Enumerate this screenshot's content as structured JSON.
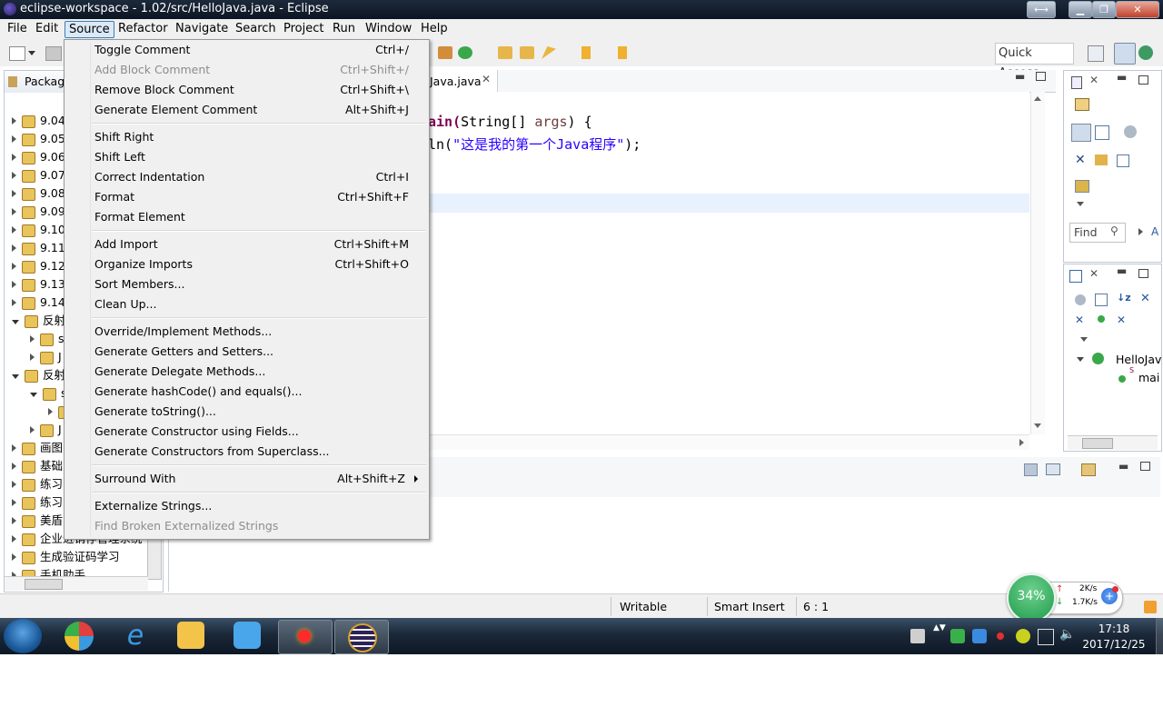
{
  "window": {
    "title": "eclipse-workspace - 1.02/src/HelloJava.java - Eclipse"
  },
  "menubar": [
    "File",
    "Edit",
    "Source",
    "Refactor",
    "Navigate",
    "Search",
    "Project",
    "Run",
    "Window",
    "Help"
  ],
  "toolbar": {
    "quick_access": "Quick Access"
  },
  "package_explorer": {
    "tab_label": "Packag",
    "rows": [
      "9.04",
      "9.05",
      "9.06",
      "9.07",
      "9.08",
      "9.09",
      "9.10",
      "9.11",
      "9.12",
      "9.13",
      "9.14",
      "反射",
      "s",
      "J",
      "反射",
      "s",
      "",
      "J",
      "画图",
      "基础",
      "练习",
      "练习",
      "美盾",
      "企业进销存管理系统",
      "生成验证码学习",
      "手机助手"
    ]
  },
  "editor": {
    "tab_label": "Java.java",
    "line1_a": "ain(",
    "line1_b": "String[] ",
    "line1_c": "args",
    "line1_d": ") {",
    "line2_a": "ln(",
    "line2_b": "\"这是我的第一个Java程序\"",
    "line2_c": ");"
  },
  "source_menu": {
    "groups": [
      [
        {
          "label": "Toggle Comment",
          "accel": "Ctrl+/",
          "enabled": true
        },
        {
          "label": "Add Block Comment",
          "accel": "Ctrl+Shift+/",
          "enabled": false
        },
        {
          "label": "Remove Block Comment",
          "accel": "Ctrl+Shift+\\",
          "enabled": true
        },
        {
          "label": "Generate Element Comment",
          "accel": "Alt+Shift+J",
          "enabled": true
        }
      ],
      [
        {
          "label": "Shift Right",
          "accel": "",
          "enabled": true
        },
        {
          "label": "Shift Left",
          "accel": "",
          "enabled": true
        },
        {
          "label": "Correct Indentation",
          "accel": "Ctrl+I",
          "enabled": true
        },
        {
          "label": "Format",
          "accel": "Ctrl+Shift+F",
          "enabled": true
        },
        {
          "label": "Format Element",
          "accel": "",
          "enabled": true
        }
      ],
      [
        {
          "label": "Add Import",
          "accel": "Ctrl+Shift+M",
          "enabled": true
        },
        {
          "label": "Organize Imports",
          "accel": "Ctrl+Shift+O",
          "enabled": true
        },
        {
          "label": "Sort Members...",
          "accel": "",
          "enabled": true
        },
        {
          "label": "Clean Up...",
          "accel": "",
          "enabled": true
        }
      ],
      [
        {
          "label": "Override/Implement Methods...",
          "accel": "",
          "enabled": true
        },
        {
          "label": "Generate Getters and Setters...",
          "accel": "",
          "enabled": true
        },
        {
          "label": "Generate Delegate Methods...",
          "accel": "",
          "enabled": true
        },
        {
          "label": "Generate hashCode() and equals()...",
          "accel": "",
          "enabled": true
        },
        {
          "label": "Generate toString()...",
          "accel": "",
          "enabled": true
        },
        {
          "label": "Generate Constructor using Fields...",
          "accel": "",
          "enabled": true
        },
        {
          "label": "Generate Constructors from Superclass...",
          "accel": "",
          "enabled": true
        }
      ],
      [
        {
          "label": "Surround With",
          "accel": "Alt+Shift+Z",
          "enabled": true,
          "submenu": true
        }
      ],
      [
        {
          "label": "Externalize Strings...",
          "accel": "",
          "enabled": true
        },
        {
          "label": "Find Broken Externalized Strings",
          "accel": "",
          "enabled": false
        }
      ]
    ]
  },
  "outline": {
    "find_placeholder": "Find",
    "find_extra": "A",
    "class_name": "HelloJav",
    "method_name": "mai",
    "static_mark": "S"
  },
  "status": {
    "writable": "Writable",
    "insert_mode": "Smart Insert",
    "position": "6 : 1"
  },
  "net_widget": {
    "percent": "34%",
    "up": "2K/s",
    "down": "1.7K/s"
  },
  "clock": {
    "time": "17:18",
    "date": "2017/12/25"
  }
}
